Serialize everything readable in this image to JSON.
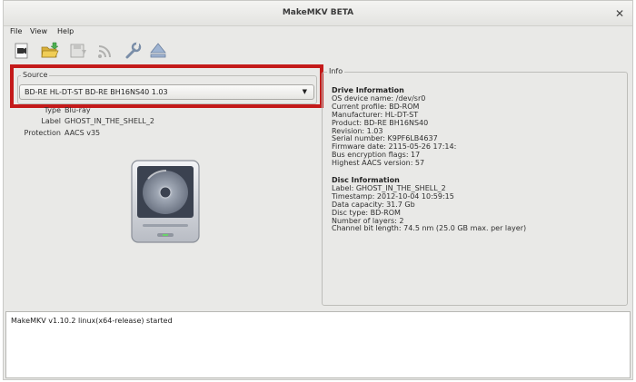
{
  "window": {
    "title": "MakeMKV BETA",
    "close_glyph": "✕"
  },
  "menu": [
    {
      "label": "File"
    },
    {
      "label": "View"
    },
    {
      "label": "Help"
    }
  ],
  "toolbar": [
    {
      "icon": "open-video-file-icon"
    },
    {
      "icon": "open-folder-icon"
    },
    {
      "icon": "backup-icon"
    },
    {
      "icon": "stream-icon"
    },
    {
      "icon": "settings-wrench-icon"
    },
    {
      "icon": "eject-icon"
    }
  ],
  "source": {
    "group_label": "Source",
    "selected_drive": "BD-RE HL-DT-ST BD-RE  BH16NS40 1.03",
    "dropdown_glyph": "▼"
  },
  "disc_props": [
    {
      "key": "Type",
      "value": "Blu-ray"
    },
    {
      "key": "Label",
      "value": "GHOST_IN_THE_SHELL_2"
    },
    {
      "key": "Protection",
      "value": "AACS v35"
    }
  ],
  "info": {
    "group_label": "Info",
    "drive": {
      "heading": "Drive Information",
      "lines": [
        "OS device name: /dev/sr0",
        "Current profile: BD-ROM",
        "Manufacturer: HL-DT-ST",
        "Product: BD-RE BH16NS40",
        "Revision: 1.03",
        "Serial number: K9PF6LB4637",
        "Firmware date: 2115-05-26 17:14:",
        "Bus encryption flags: 17",
        "Highest AACS version: 57"
      ]
    },
    "disc": {
      "heading": "Disc Information",
      "lines": [
        "Label: GHOST_IN_THE_SHELL_2",
        "Timestamp: 2012-10-04 10:59:15",
        "Data capacity: 31.7 Gb",
        "Disc type: BD-ROM",
        "Number of layers: 2",
        "Channel bit length: 74.5 nm (25.0 GB max. per layer)"
      ]
    }
  },
  "log": {
    "lines": [
      "MakeMKV v1.10.2 linux(x64-release) started"
    ]
  },
  "colors": {
    "highlight": "#c41a1a",
    "window_bg": "#e9e9e7",
    "log_bg": "#ffffff"
  }
}
